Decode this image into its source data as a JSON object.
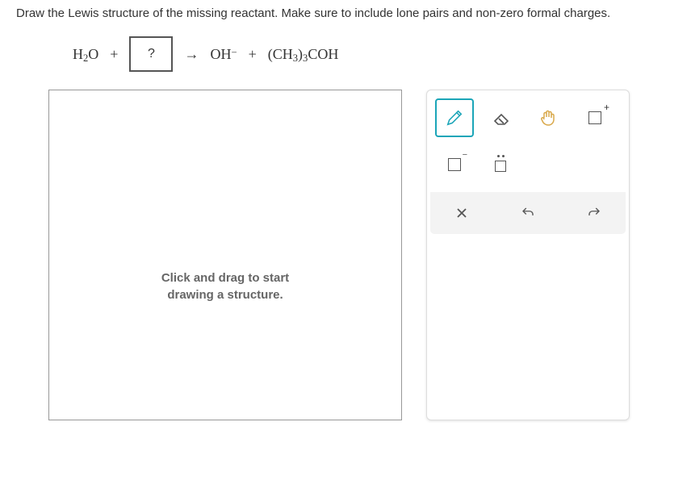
{
  "instruction": "Draw the Lewis structure of the missing reactant. Make sure to include lone pairs and non-zero formal charges.",
  "eq": {
    "r1_a": "H",
    "r1_sub": "2",
    "r1_b": "O",
    "plus1": "+",
    "unknown": "?",
    "arrow": "→",
    "p1_a": "OH",
    "p1_sup": "−",
    "plus2": "+",
    "p2_a": "(CH",
    "p2_sub1": "3",
    "p2_b": ")",
    "p2_sub2": "3",
    "p2_c": "COH"
  },
  "canvas": {
    "hint_l1": "Click and drag to start",
    "hint_l2": "drawing a structure."
  },
  "tools": {
    "pencil": "pencil-icon",
    "eraser": "eraser-icon",
    "hand": "hand-icon",
    "charge_plus": "charge-plus-icon",
    "charge_minus": "charge-minus-icon",
    "lone_pair": "lone-pair-icon",
    "clear": "clear-icon",
    "undo": "undo-icon",
    "redo": "redo-icon"
  }
}
